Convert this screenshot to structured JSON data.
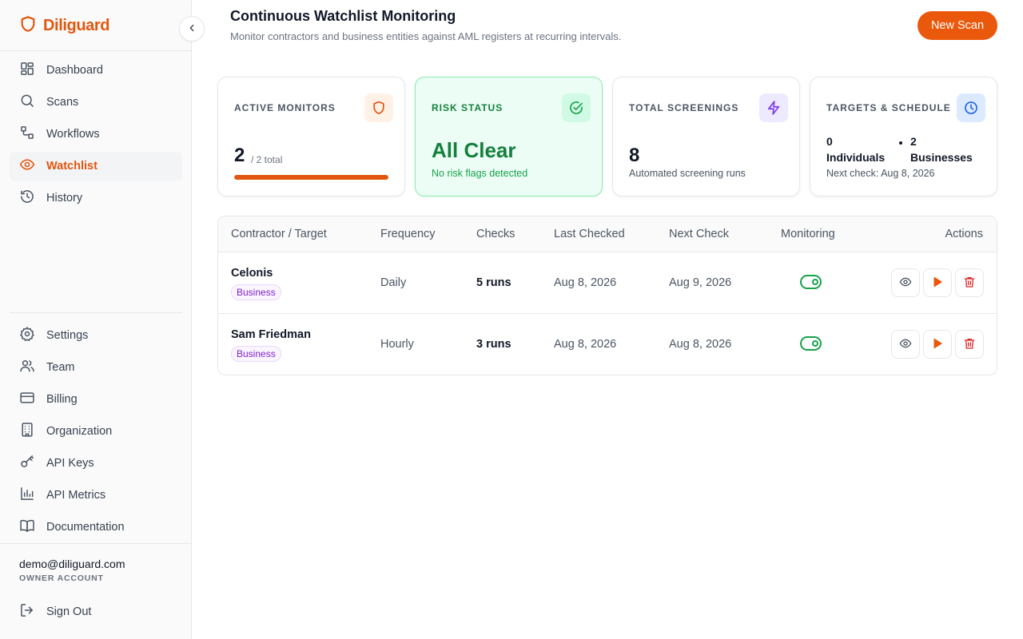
{
  "brand": {
    "name": "Diliguard"
  },
  "sidebar": {
    "primary": [
      {
        "label": "Dashboard",
        "icon": "dashboard-icon",
        "active": false
      },
      {
        "label": "Scans",
        "icon": "search-icon",
        "active": false
      },
      {
        "label": "Workflows",
        "icon": "workflow-icon",
        "active": false
      },
      {
        "label": "Watchlist",
        "icon": "eye-icon",
        "active": true
      },
      {
        "label": "History",
        "icon": "history-icon",
        "active": false
      }
    ],
    "secondary": [
      {
        "label": "Settings",
        "icon": "gear-icon"
      },
      {
        "label": "Team",
        "icon": "users-icon"
      },
      {
        "label": "Billing",
        "icon": "credit-card-icon"
      },
      {
        "label": "Organization",
        "icon": "building-icon"
      },
      {
        "label": "API Keys",
        "icon": "key-icon"
      },
      {
        "label": "API Metrics",
        "icon": "bar-chart-icon"
      },
      {
        "label": "Documentation",
        "icon": "book-icon"
      }
    ],
    "user": {
      "email": "demo@diliguard.com",
      "role": "OWNER ACCOUNT"
    },
    "sign_out": "Sign Out"
  },
  "header": {
    "title": "Continuous Watchlist Monitoring",
    "subtitle": "Monitor contractors and business entities against AML registers at recurring intervals.",
    "new_scan": "New Scan"
  },
  "cards": {
    "active_monitors": {
      "label": "ACTIVE MONITORS",
      "value": "2",
      "total": "/ 2 total",
      "progress_percent": 100
    },
    "risk_status": {
      "label": "RISK STATUS",
      "value": "All Clear",
      "sub": "No risk flags detected"
    },
    "total_screenings": {
      "label": "TOTAL SCREENINGS",
      "value": "8",
      "sub": "Automated screening runs"
    },
    "targets": {
      "label": "TARGETS & SCHEDULE",
      "individuals_count": "0",
      "individuals_label": "Individuals",
      "businesses_count": "2",
      "businesses_label": "Businesses",
      "next_check": "Next check: Aug 8, 2026"
    }
  },
  "table": {
    "headers": [
      "Contractor / Target",
      "Frequency",
      "Checks",
      "Last Checked",
      "Next Check",
      "Monitoring",
      "Actions"
    ],
    "rows": [
      {
        "name": "Celonis",
        "type": "Business",
        "frequency": "Daily",
        "checks": "5 runs",
        "last_checked": "Aug 8, 2026",
        "next_check": "Aug 9, 2026",
        "monitoring": true
      },
      {
        "name": "Sam Friedman",
        "type": "Business",
        "frequency": "Hourly",
        "checks": "3 runs",
        "last_checked": "Aug 8, 2026",
        "next_check": "Aug 8, 2026",
        "monitoring": true
      }
    ]
  },
  "colors": {
    "brand": "#e2570f",
    "success": "#16a34a",
    "danger": "#dc2626",
    "accent_purple": "#7c3aed",
    "accent_blue": "#2563eb"
  }
}
